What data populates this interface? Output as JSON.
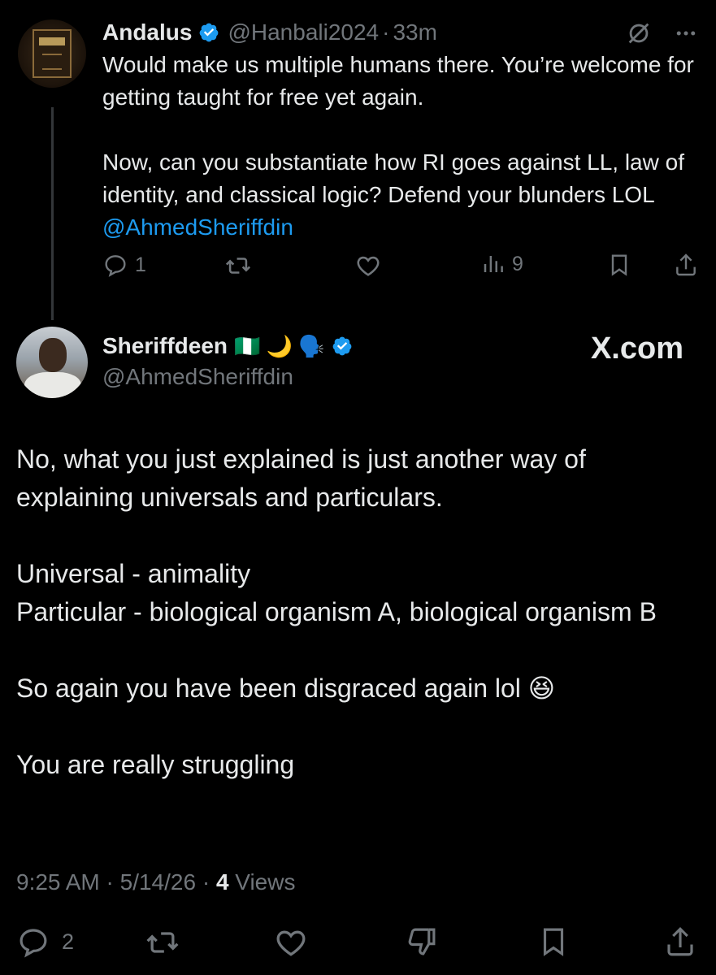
{
  "tweet1": {
    "name": "Andalus",
    "handle": "@Hanbali2024",
    "sep": "·",
    "time": "33m",
    "line1": "Would make us multiple humans there. You’re welcome for getting taught for free yet again.",
    "line2_text": "Now, can you substantiate how RI goes against LL, law of identity, and classical logic? Defend your blunders LOL ",
    "line2_mention": "@AhmedSheriffdin",
    "replies": "1",
    "views": "9",
    "icons": [
      "grok-slash-icon",
      "more-icon",
      "reply-icon",
      "retweet-icon",
      "like-icon",
      "views-icon",
      "bookmark-icon",
      "share-icon"
    ]
  },
  "tweet2": {
    "name": "Sheriffdeen",
    "emojis": "🇳🇬 🌙 🗣️",
    "handle": "@AhmedSheriffdin",
    "watermark": "X.com",
    "paragraphs": {
      "p1": "No, what you just explained is just another way of explaining universals and particulars.",
      "p2a": "Universal - animality",
      "p2b": "Particular - biological organism A, biological organism B",
      "p3": "So again you have been disgraced again lol 😆",
      "p4": "You are really struggling"
    },
    "meta": {
      "time": "9:25 AM",
      "sep1": " · ",
      "date": "5/14/26",
      "sep2": " · ",
      "views_count": "4",
      "views_label": " Views"
    },
    "replies": "2"
  },
  "colors": {
    "background": "#000000",
    "text": "#e7e9ea",
    "muted": "#71767b",
    "link": "#1d9bf0",
    "verified": "#1d9bf0"
  }
}
